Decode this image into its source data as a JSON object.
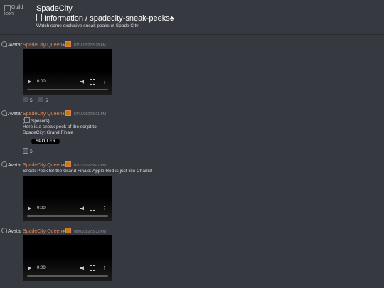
{
  "header": {
    "guild_icon_alt": "Guild icon",
    "guild_name": "SpadeCity",
    "channel_path": "Information / spadecity-sneak-peeks",
    "channel_suffix": "♠",
    "topic": "Watch some exclusive sneak peaks of Spade City!"
  },
  "messages": [
    {
      "avatar_alt": "Avatar",
      "author": "SpadeCity Queen♠",
      "timestamp": "07/16/2022 5:28 AM",
      "video": {
        "time": "0:00"
      },
      "reactions": [
        {
          "count": "5"
        },
        {
          "count": "5"
        }
      ]
    },
    {
      "avatar_alt": "Avatar",
      "author": "SpadeCity Queen♠",
      "timestamp": "07/16/2022 5:01 PM",
      "spoiler_line": "Spoilers)",
      "spoiler_open": "(",
      "text_line1": "Here is a sneak peek of the script to",
      "text_line2": "SpadeCity: Grand Finale",
      "spoiler_label": "SPOILER",
      "reactions": [
        {
          "count": "5"
        }
      ]
    },
    {
      "avatar_alt": "Avatar",
      "author": "SpadeCity Queen♠",
      "timestamp": "07/23/2022 9:07 PM",
      "text": "Sneak Peek for the Grand Finale: Apple Red is just like Charlie!",
      "video": {
        "time": "0:00"
      }
    },
    {
      "avatar_alt": "Avatar",
      "author": "SpadeCity Queen♠",
      "timestamp": "08/02/2022 5:32 PM",
      "video": {
        "time": "0:00"
      }
    }
  ]
}
